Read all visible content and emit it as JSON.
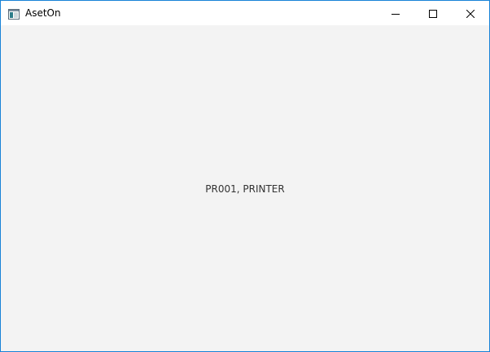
{
  "window": {
    "title": "AsetOn",
    "accent_border": "#1883d7",
    "titlebar_bg": "#ffffff",
    "content_bg": "#f3f3f3",
    "icons": {
      "app": "app-window-icon",
      "minimize": "minimize-icon",
      "maximize": "maximize-icon",
      "close": "close-icon"
    }
  },
  "content": {
    "label": "PR001, PRINTER"
  }
}
